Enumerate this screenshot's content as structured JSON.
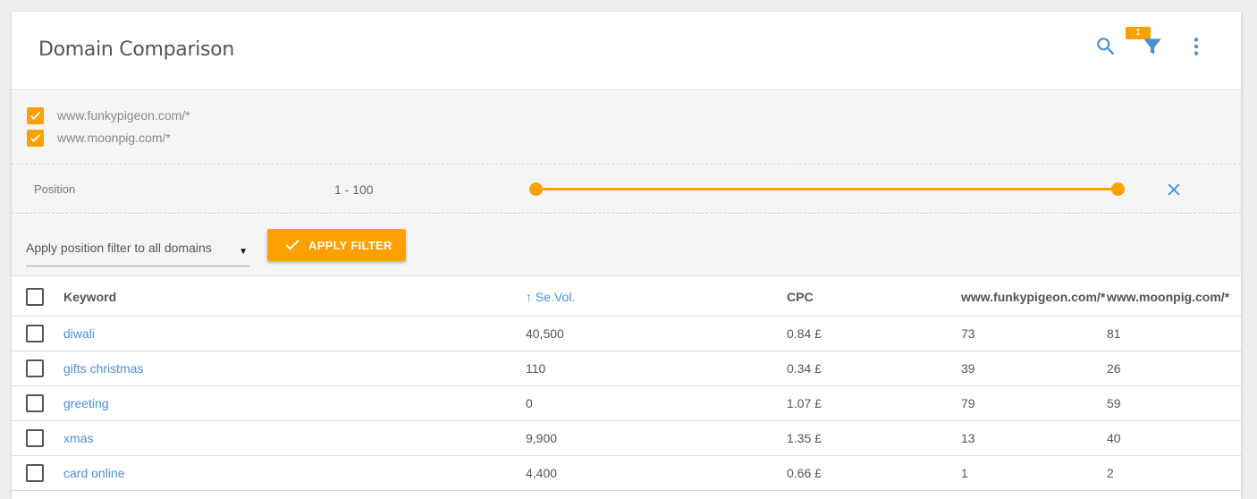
{
  "header": {
    "title": "Domain Comparison",
    "filter_badge": "1",
    "icons": [
      "search-icon",
      "filter-icon",
      "more-vert-icon"
    ]
  },
  "domains": [
    {
      "label": "www.funkypigeon.com/*",
      "checked": true
    },
    {
      "label": "www.moonpig.com/*",
      "checked": true
    }
  ],
  "position_filter": {
    "label": "Position",
    "range_text": "1 - 100",
    "min": 1,
    "max": 100
  },
  "apply": {
    "select_value": "Apply position filter to all domains",
    "button_label": "APPLY FILTER"
  },
  "table": {
    "headers": {
      "keyword": "Keyword",
      "volume": "Se.Vol.",
      "cpc": "CPC",
      "domain1": "www.funkypigeon.com/*",
      "domain2": "www.moonpig.com/*"
    },
    "sort_arrow": "↑",
    "rows": [
      {
        "keyword": "diwali",
        "volume": "40,500",
        "cpc": "0.84 £",
        "d1": "73",
        "d2": "81"
      },
      {
        "keyword": "gifts christmas",
        "volume": "110",
        "cpc": "0.34 £",
        "d1": "39",
        "d2": "26"
      },
      {
        "keyword": "greeting",
        "volume": "0",
        "cpc": "1.07 £",
        "d1": "79",
        "d2": "59"
      },
      {
        "keyword": "xmas",
        "volume": "9,900",
        "cpc": "1.35 £",
        "d1": "13",
        "d2": "40"
      },
      {
        "keyword": "card online",
        "volume": "4,400",
        "cpc": "0.66 £",
        "d1": "1",
        "d2": "2"
      }
    ]
  },
  "colors": {
    "accent": "#ffa000",
    "link": "#4a8fd4"
  }
}
